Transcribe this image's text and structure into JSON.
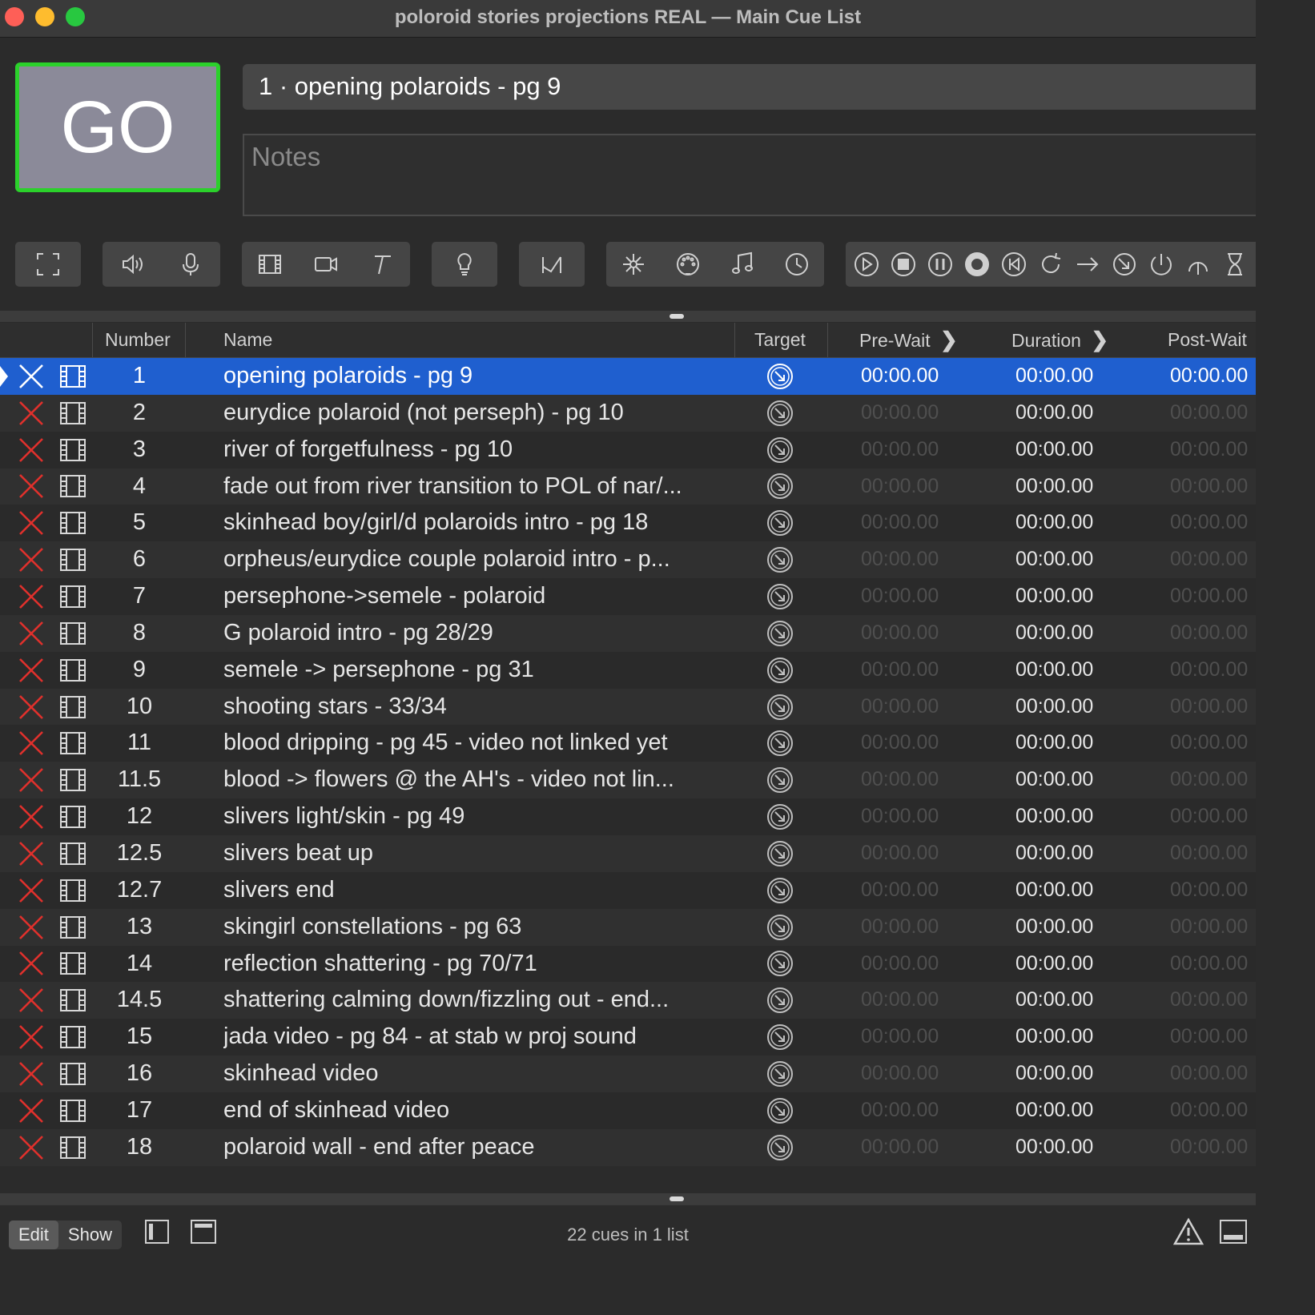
{
  "window": {
    "title": "poloroid stories projections REAL — Main Cue List"
  },
  "go_button": {
    "label": "GO"
  },
  "current_cue": {
    "title": "1 · opening polaroids - pg 9",
    "notes_placeholder": "Notes"
  },
  "toolbar": {
    "groups": [
      [
        "fullscreen-icon"
      ],
      [
        "audio-icon",
        "mic-icon"
      ],
      [
        "video-icon",
        "camera-icon",
        "text-icon"
      ],
      [
        "light-icon"
      ],
      [
        "fade-icon"
      ],
      [
        "network-icon",
        "midi-icon",
        "music-icon",
        "timecode-icon"
      ],
      [
        "start-icon",
        "stop-icon",
        "pause-icon",
        "load-icon",
        "reset-icon",
        "devamp-icon",
        "goto-icon",
        "target-icon",
        "arm-icon",
        "disarm-icon",
        "wait-icon"
      ]
    ]
  },
  "table": {
    "headers": {
      "number": "Number",
      "name": "Name",
      "target": "Target",
      "pre_wait": "Pre-Wait",
      "duration": "Duration",
      "post_wait": "Post-Wait"
    },
    "rows": [
      {
        "number": "1",
        "name": "opening polaroids - pg 9",
        "pre": "00:00.00",
        "dur": "00:00.00",
        "post": "00:00.00",
        "selected": true
      },
      {
        "number": "2",
        "name": "eurydice polaroid (not perseph) - pg 10",
        "pre": "00:00.00",
        "dur": "00:00.00",
        "post": "00:00.00"
      },
      {
        "number": "3",
        "name": "river of forgetfulness - pg 10",
        "pre": "00:00.00",
        "dur": "00:00.00",
        "post": "00:00.00"
      },
      {
        "number": "4",
        "name": "fade out from river transition to POL of nar/...",
        "pre": "00:00.00",
        "dur": "00:00.00",
        "post": "00:00.00"
      },
      {
        "number": "5",
        "name": "skinhead boy/girl/d polaroids intro - pg 18",
        "pre": "00:00.00",
        "dur": "00:00.00",
        "post": "00:00.00"
      },
      {
        "number": "6",
        "name": "orpheus/eurydice couple polaroid intro - p...",
        "pre": "00:00.00",
        "dur": "00:00.00",
        "post": "00:00.00"
      },
      {
        "number": "7",
        "name": "persephone->semele - polaroid",
        "pre": "00:00.00",
        "dur": "00:00.00",
        "post": "00:00.00"
      },
      {
        "number": "8",
        "name": "G polaroid intro - pg 28/29",
        "pre": "00:00.00",
        "dur": "00:00.00",
        "post": "00:00.00"
      },
      {
        "number": "9",
        "name": "semele -> persephone - pg 31",
        "pre": "00:00.00",
        "dur": "00:00.00",
        "post": "00:00.00"
      },
      {
        "number": "10",
        "name": "shooting stars - 33/34",
        "pre": "00:00.00",
        "dur": "00:00.00",
        "post": "00:00.00"
      },
      {
        "number": "11",
        "name": "blood dripping - pg 45 - video not linked yet",
        "pre": "00:00.00",
        "dur": "00:00.00",
        "post": "00:00.00"
      },
      {
        "number": "11.5",
        "name": "blood -> flowers @ the AH's - video not lin...",
        "pre": "00:00.00",
        "dur": "00:00.00",
        "post": "00:00.00"
      },
      {
        "number": "12",
        "name": "slivers light/skin - pg 49",
        "pre": "00:00.00",
        "dur": "00:00.00",
        "post": "00:00.00"
      },
      {
        "number": "12.5",
        "name": "slivers beat up",
        "pre": "00:00.00",
        "dur": "00:00.00",
        "post": "00:00.00"
      },
      {
        "number": "12.7",
        "name": "slivers end",
        "pre": "00:00.00",
        "dur": "00:00.00",
        "post": "00:00.00"
      },
      {
        "number": "13",
        "name": "skingirl constellations - pg 63",
        "pre": "00:00.00",
        "dur": "00:00.00",
        "post": "00:00.00"
      },
      {
        "number": "14",
        "name": "reflection shattering - pg 70/71",
        "pre": "00:00.00",
        "dur": "00:00.00",
        "post": "00:00.00"
      },
      {
        "number": "14.5",
        "name": "shattering calming down/fizzling out - end...",
        "pre": "00:00.00",
        "dur": "00:00.00",
        "post": "00:00.00"
      },
      {
        "number": "15",
        "name": "jada video - pg 84 - at stab w proj sound",
        "pre": "00:00.00",
        "dur": "00:00.00",
        "post": "00:00.00"
      },
      {
        "number": "16",
        "name": "skinhead video",
        "pre": "00:00.00",
        "dur": "00:00.00",
        "post": "00:00.00"
      },
      {
        "number": "17",
        "name": "end of skinhead video",
        "pre": "00:00.00",
        "dur": "00:00.00",
        "post": "00:00.00"
      },
      {
        "number": "18",
        "name": "polaroid wall - end after peace",
        "pre": "00:00.00",
        "dur": "00:00.00",
        "post": "00:00.00"
      }
    ]
  },
  "statusbar": {
    "edit_label": "Edit",
    "show_label": "Show",
    "status_text": "22 cues in 1 list"
  },
  "colors": {
    "go_border": "#2bd12b",
    "selection": "#1f5fcf",
    "broken_x": "#e0302c"
  }
}
